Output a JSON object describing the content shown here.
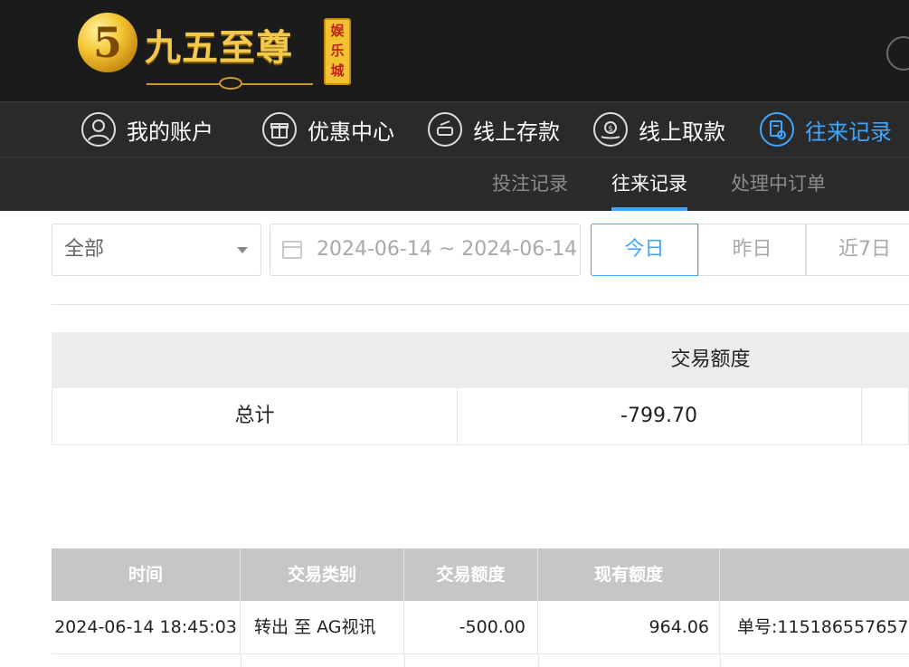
{
  "brand": {
    "logo_digit": "5",
    "name": "九五至尊",
    "stamp": "娱乐城"
  },
  "nav": {
    "items": [
      {
        "label": "我的账户",
        "icon": "user-icon"
      },
      {
        "label": "优惠中心",
        "icon": "gift-icon"
      },
      {
        "label": "线上存款",
        "icon": "deposit-icon"
      },
      {
        "label": "线上取款",
        "icon": "withdraw-icon"
      },
      {
        "label": "往来记录",
        "icon": "records-icon",
        "active": true
      }
    ]
  },
  "subnav": {
    "items": [
      {
        "label": "投注记录"
      },
      {
        "label": "往来记录",
        "active": true
      },
      {
        "label": "处理中订单"
      }
    ]
  },
  "filters": {
    "type_select": "全部",
    "date_range": "2024-06-14 ~ 2024-06-14",
    "quick": [
      "今日",
      "昨日",
      "近7日"
    ],
    "quick_active": "今日"
  },
  "summary": {
    "header": "交易额度",
    "row_label": "总计",
    "total": "-799.70"
  },
  "records": {
    "columns": [
      "时间",
      "交易类别",
      "交易额度",
      "现有额度",
      ""
    ],
    "rows": [
      {
        "time": "2024-06-14 18:45:03",
        "type": "转出 至 AG视讯",
        "amount": "-500.00",
        "balance": "964.06",
        "note": "单号:115186557657"
      }
    ]
  },
  "colors": {
    "accent": "#3ea6ff",
    "header_bg": "#1b1b1b",
    "nav_bg": "#2a2a2a",
    "gold": "#f2c94c"
  }
}
